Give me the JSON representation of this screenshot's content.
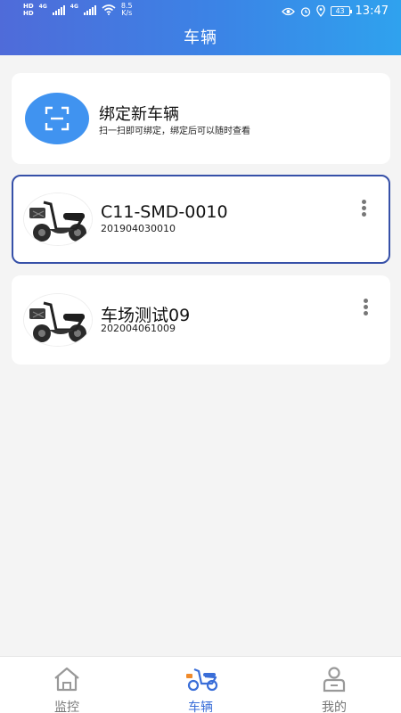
{
  "status_bar": {
    "hd1": "HD",
    "hd2": "HD",
    "net1": "4G",
    "net2": "4G",
    "speed_value": "8.5",
    "speed_unit": "K/s",
    "battery": "43",
    "time": "13:47"
  },
  "header": {
    "title": "车辆"
  },
  "bind_card": {
    "title": "绑定新车辆",
    "subtitle": "扫一扫即可绑定，绑定后可以随时查看",
    "icon": "scan-icon"
  },
  "vehicles": [
    {
      "name": "C11-SMD-0010",
      "id": "201904030010",
      "selected": true
    },
    {
      "name": "车场测试09",
      "id": "202004061009",
      "selected": false
    }
  ],
  "tabs": [
    {
      "label": "监控",
      "icon": "home-icon",
      "active": false
    },
    {
      "label": "车辆",
      "icon": "scooter-icon",
      "active": true
    },
    {
      "label": "我的",
      "icon": "user-icon",
      "active": false
    }
  ],
  "colors": {
    "header_start": "#4f6bd9",
    "header_end": "#2fa2ee",
    "accent": "#4093f0",
    "selected_border": "#3650a8",
    "tab_active": "#3a6ed8"
  }
}
